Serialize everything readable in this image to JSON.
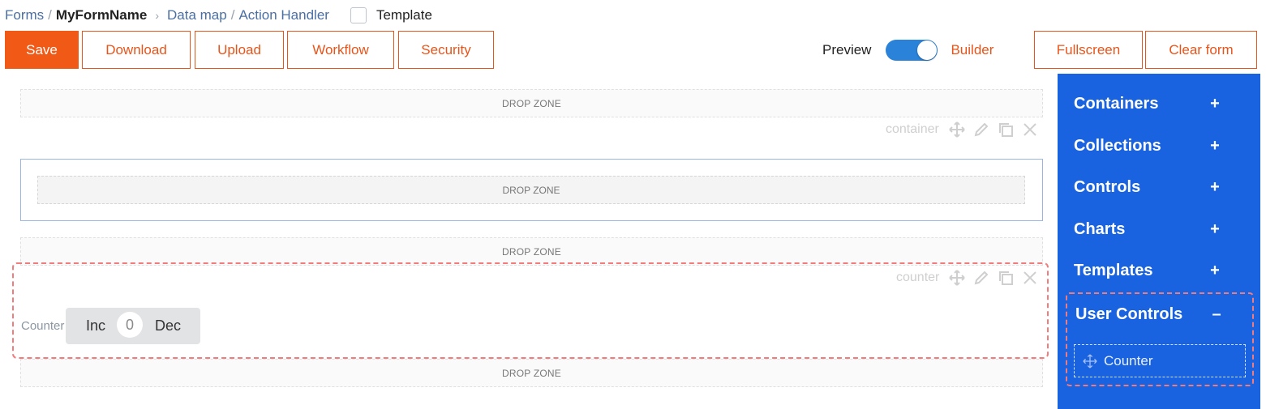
{
  "breadcrumb": {
    "forms": "Forms",
    "sep1": "/",
    "form_name": "MyFormName",
    "chevron": "›",
    "data_map": "Data map",
    "sep2": "/",
    "action_handler": "Action Handler"
  },
  "template_checkbox": {
    "label": "Template",
    "checked": false
  },
  "toolbar": {
    "save": "Save",
    "download": "Download",
    "upload": "Upload",
    "workflow": "Workflow",
    "security": "Security",
    "fullscreen": "Fullscreen",
    "clear_form": "Clear form"
  },
  "mode_toggle": {
    "preview_label": "Preview",
    "builder_label": "Builder",
    "state": "builder"
  },
  "canvas": {
    "drop_zone_label": "DROP ZONE",
    "container_tools_label": "container",
    "counter_tools_label": "counter",
    "counter": {
      "label": "Counter",
      "inc_label": "Inc",
      "value": "0",
      "dec_label": "Dec"
    }
  },
  "sidebar": {
    "items": [
      {
        "label": "Containers",
        "toggle": "+"
      },
      {
        "label": "Collections",
        "toggle": "+"
      },
      {
        "label": "Controls",
        "toggle": "+"
      },
      {
        "label": "Charts",
        "toggle": "+"
      },
      {
        "label": "Templates",
        "toggle": "+"
      },
      {
        "label": "User Controls",
        "toggle": "–"
      }
    ],
    "user_controls": [
      {
        "label": "Counter",
        "icon": "move-icon"
      }
    ]
  },
  "colors": {
    "accent_orange": "#f15a16",
    "sidebar_blue": "#1a63e0",
    "toggle_blue": "#2b82d9",
    "selection_dashed": "#f27c7c"
  }
}
